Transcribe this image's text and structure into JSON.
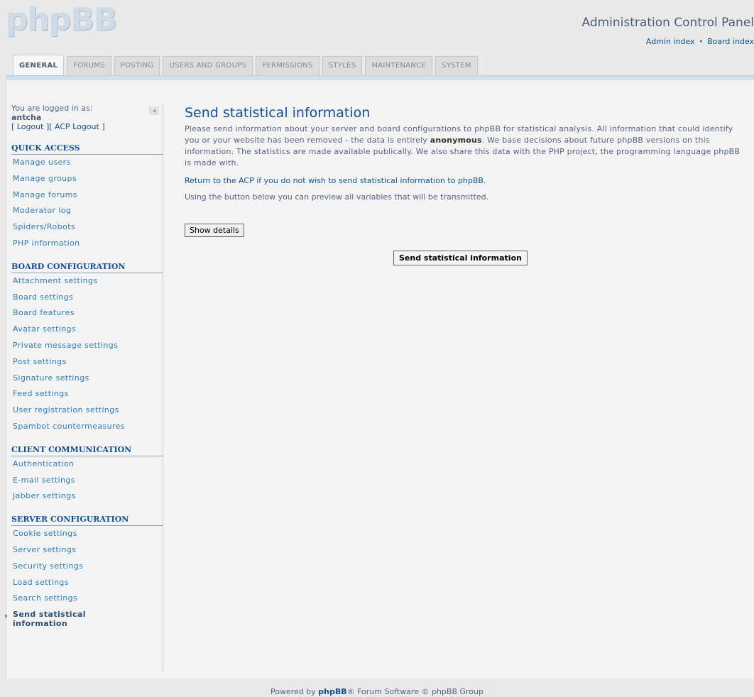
{
  "header": {
    "logo_text": "phpBB",
    "title": "Administration Control Panel",
    "links": {
      "admin_index": "Admin index",
      "separator": "•",
      "board_index": "Board index"
    }
  },
  "tabs": [
    "GENERAL",
    "FORUMS",
    "POSTING",
    "USERS AND GROUPS",
    "PERMISSIONS",
    "STYLES",
    "MAINTENANCE",
    "SYSTEM"
  ],
  "active_tab": "GENERAL",
  "sidebar": {
    "logged_in_label": "You are logged in as:",
    "username": "antcha",
    "logout_links": "[ Logout ][ ACP Logout ]",
    "sections": [
      {
        "heading": "QUICK ACCESS",
        "items": [
          "Manage users",
          "Manage groups",
          "Manage forums",
          "Moderator log",
          "Spiders/Robots",
          "PHP information"
        ]
      },
      {
        "heading": "BOARD CONFIGURATION",
        "items": [
          "Attachment settings",
          "Board settings",
          "Board features",
          "Avatar settings",
          "Private message settings",
          "Post settings",
          "Signature settings",
          "Feed settings",
          "User registration settings",
          "Spambot countermeasures"
        ]
      },
      {
        "heading": "CLIENT COMMUNICATION",
        "items": [
          "Authentication",
          "E-mail settings",
          "Jabber settings"
        ]
      },
      {
        "heading": "SERVER CONFIGURATION",
        "items": [
          "Cookie settings",
          "Server settings",
          "Security settings",
          "Load settings",
          "Search settings"
        ]
      }
    ],
    "active_item": "Send statistical information"
  },
  "content": {
    "title": "Send statistical information",
    "intro_part1": "Please send information about your server and board configurations to phpBB for statistical analysis. All information that could identify you or your website has been removed - the data is entirely ",
    "intro_bold": "anonymous",
    "intro_part2": ". We base decisions about future phpBB versions on this information. The statistics are made available publically. We also share this data with the PHP project, the programming language phpBB is made with.",
    "return_text": "Return to the ACP if you do not wish to send statistical information to phpBB.",
    "preview_text": "Using the button below you can preview all variables that will be transmitted.",
    "show_details_label": "Show details",
    "send_label": "Send statistical information"
  },
  "footer": {
    "prefix": "Powered by ",
    "brand": "phpBB",
    "suffix": "® Forum Software © phpBB Group"
  }
}
